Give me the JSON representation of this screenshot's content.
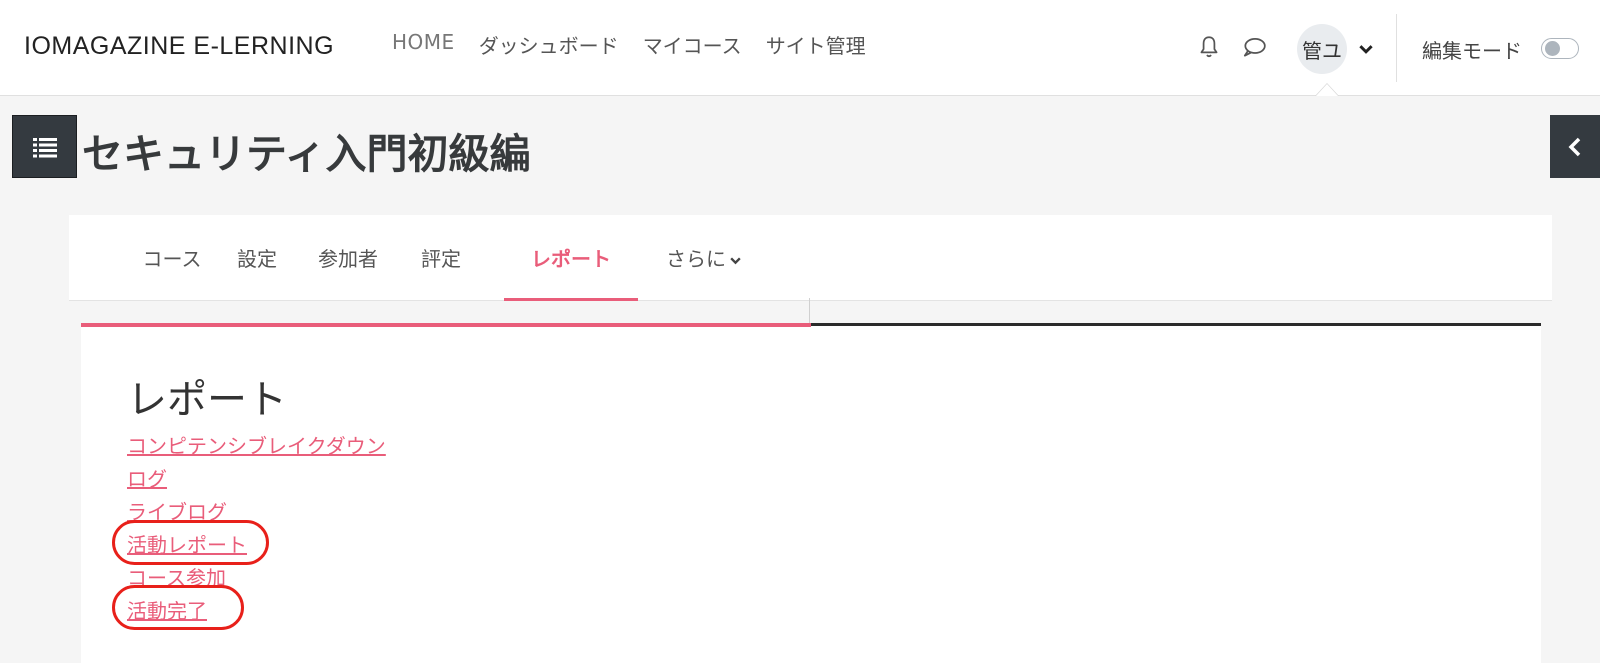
{
  "navbar": {
    "brand": "IOMAGAZINE E-LERNING",
    "links": [
      "HOME",
      "ダッシュボード",
      "マイコース",
      "サイト管理"
    ],
    "user_initials": "管ユ",
    "edit_mode_label": "編集モード",
    "edit_mode_on": false
  },
  "page": {
    "title": "セキュリティ入門初級編"
  },
  "secondary_nav": {
    "tabs": [
      "コース",
      "設定",
      "参加者",
      "評定",
      "レポート",
      "さらに"
    ],
    "active_tab": "レポート"
  },
  "reports": {
    "heading": "レポート",
    "links": [
      "コンピテンシブレイクダウン",
      "ログ",
      "ライブログ",
      "活動レポート",
      "コース参加",
      "活動完了"
    ],
    "highlighted": [
      "活動レポート",
      "活動完了"
    ]
  },
  "colors": {
    "accent": "#e95d7a",
    "annotation": "#e8201a",
    "drawer": "#343a40"
  }
}
